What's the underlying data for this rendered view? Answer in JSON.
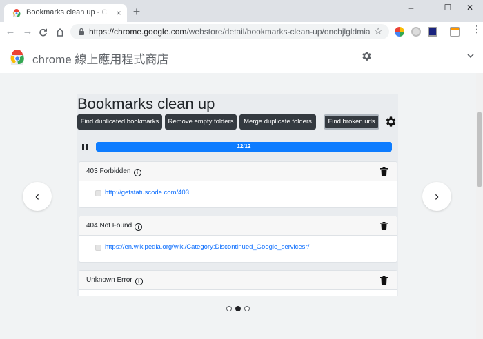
{
  "browser": {
    "tab_title": "Bookmarks clean up - Chrome",
    "tab_close": "×",
    "new_tab": "+",
    "url_scheme_host": "https://chrome.google.com",
    "url_path": "/webstore/detail/bookmarks-clean-up/oncbjlgldmiagj...",
    "window_controls": [
      "–",
      "☐",
      "✕"
    ]
  },
  "store": {
    "title": "chrome 線上應用程式商店"
  },
  "extension": {
    "title": "Bookmarks clean up",
    "buttons": [
      "Find duplicated bookmarks",
      "Remove empty folders",
      "Merge duplicate folders",
      "Find broken urls"
    ],
    "progress_label": "12/12",
    "progress_fraction": 1.0,
    "groups": [
      {
        "title": "403 Forbidden",
        "links": [
          "http://getstatuscode.com/403"
        ]
      },
      {
        "title": "404 Not Found",
        "links": [
          "https://en.wikipedia.org/wiki/Category:Discontinued_Google_servicesr/"
        ]
      },
      {
        "title": "Unknown Error",
        "links": []
      }
    ],
    "info_glyph": "i"
  },
  "carousel": {
    "prev": "‹",
    "next": "›",
    "dot_count": 3,
    "active_dot": 2
  },
  "colors": {
    "button_dark": "#343a40",
    "progress": "#0d7cff",
    "link": "#0d6efd"
  }
}
